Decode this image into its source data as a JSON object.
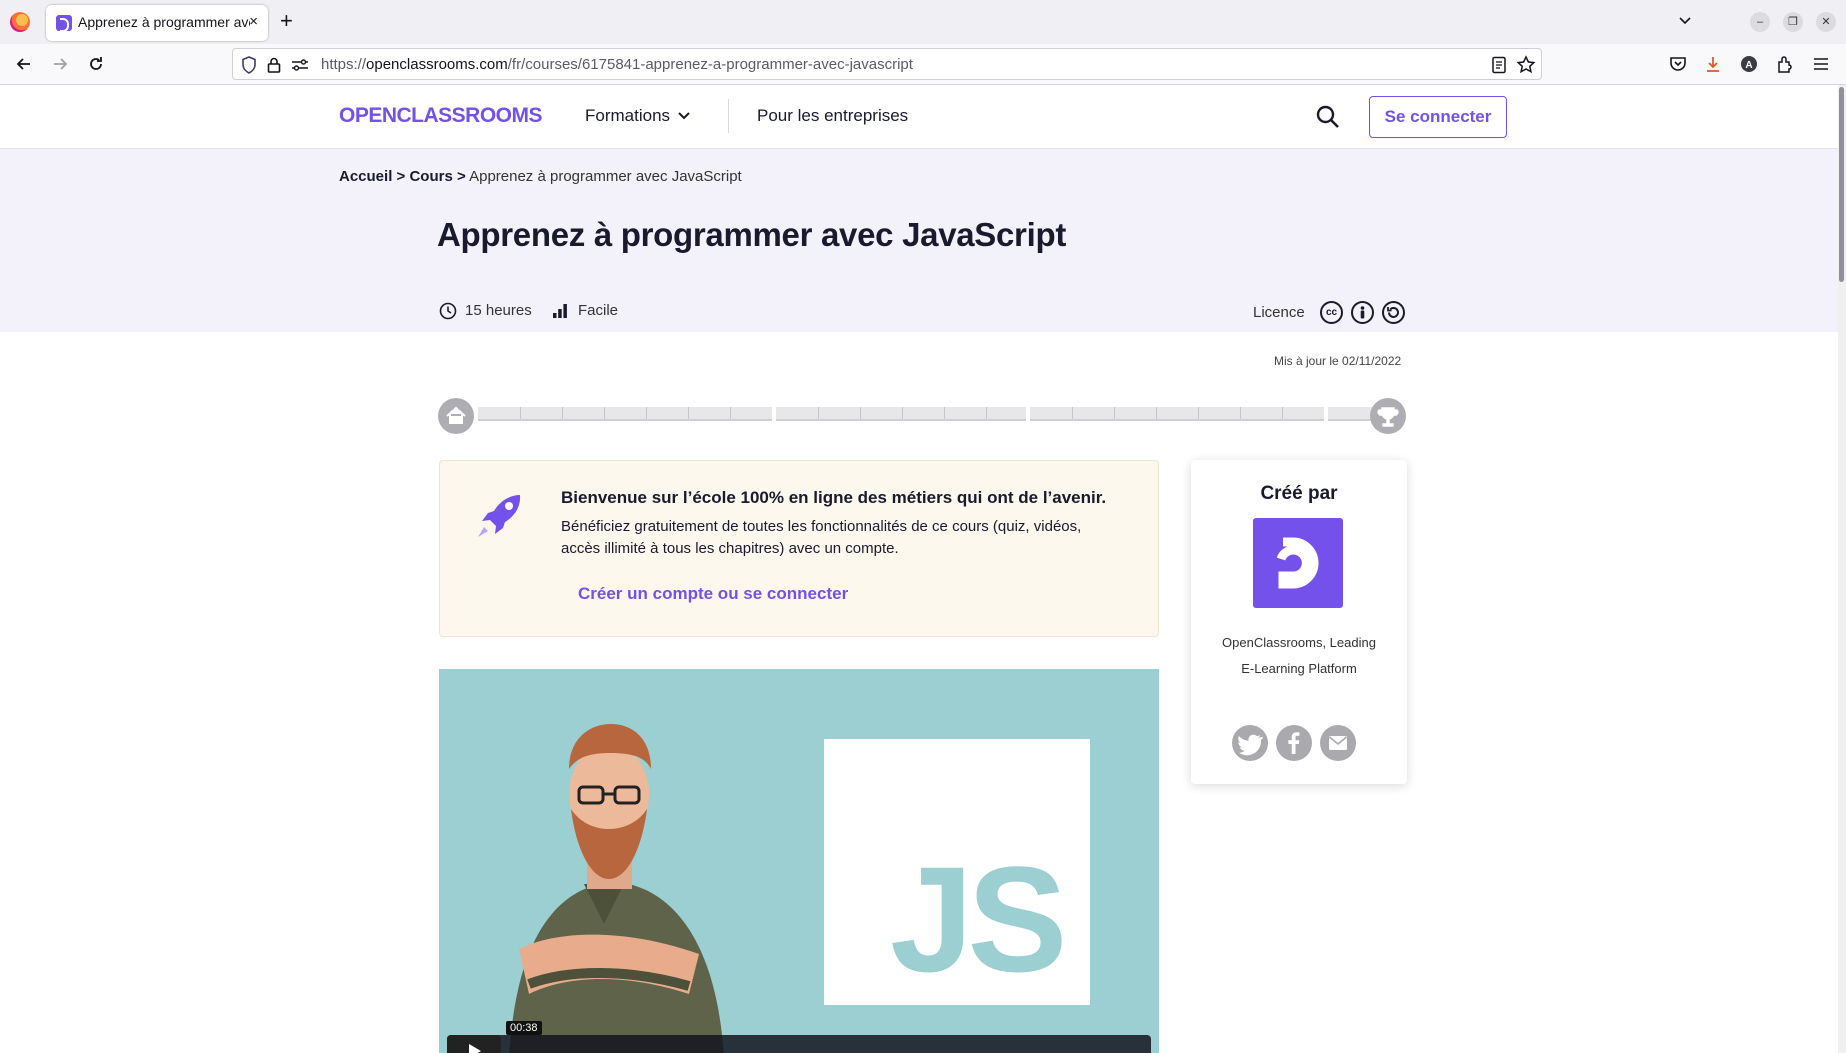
{
  "browser": {
    "tab_title": "Apprenez à programmer avec JavaScript",
    "tab_close": "×",
    "new_tab": "+",
    "url_prefix": "https://",
    "url_domain": "openclassrooms.com",
    "url_path": "/fr/courses/6175841-apprenez-a-programmer-avec-javascript"
  },
  "header": {
    "logo": "OPENCLASSROOMS",
    "formations": "Formations",
    "entreprises": "Pour les entreprises",
    "login": "Se connecter"
  },
  "breadcrumb": {
    "home": "Accueil",
    "sep": ">",
    "courses": "Cours",
    "current": "Apprenez à programmer avec JavaScript"
  },
  "course": {
    "title": "Apprenez à programmer avec JavaScript",
    "duration": "15 heures",
    "difficulty": "Facile",
    "licence_label": "Licence",
    "updated": "Mis à jour le 02/11/2022"
  },
  "welcome": {
    "title": "Bienvenue sur l’école 100% en ligne des métiers qui ont de l’avenir.",
    "body": "Bénéficiez gratuitement de toutes les fonctionnalités de ce cours (quiz, vidéos, accès illimité à tous les chapitres) avec un compte.",
    "cta": "Créer un compte ou se connecter"
  },
  "author": {
    "heading": "Créé par",
    "name_line1": "OpenClassrooms, Leading",
    "name_line2": "E-Learning Platform"
  },
  "video": {
    "logo_text": "JS",
    "time": "00:38"
  },
  "colors": {
    "brand": "#7451eb",
    "hero_bg": "#f3f2fb",
    "welcome_bg": "#fcf8ee",
    "video_bg": "#9ccfd2"
  }
}
